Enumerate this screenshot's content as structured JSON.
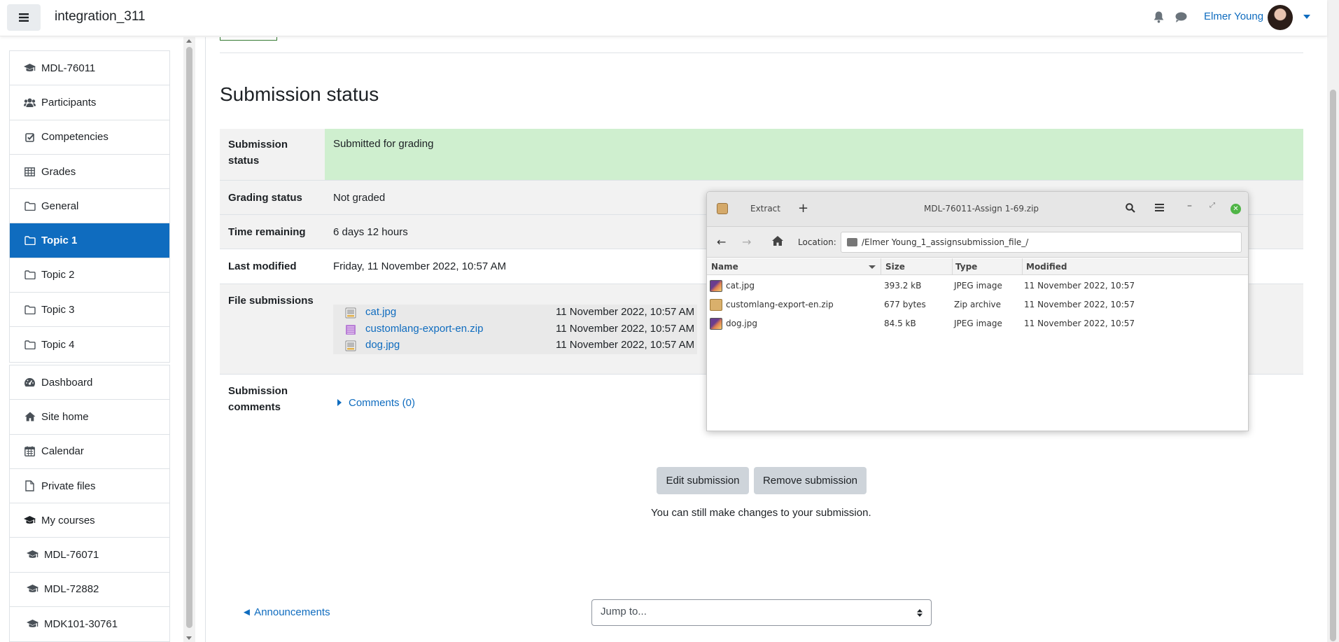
{
  "navbar": {
    "site_name": "integration_311",
    "user_name": "Elmer Young"
  },
  "sidebar": {
    "course_items": [
      {
        "label": "MDL-76011",
        "icon": "graduation-cap-icon"
      },
      {
        "label": "Participants",
        "icon": "users-icon"
      },
      {
        "label": "Competencies",
        "icon": "check-square-icon"
      },
      {
        "label": "Grades",
        "icon": "table-icon"
      },
      {
        "label": "General",
        "icon": "folder-icon"
      },
      {
        "label": "Topic 1",
        "icon": "folder-icon",
        "active": true
      },
      {
        "label": "Topic 2",
        "icon": "folder-icon"
      },
      {
        "label": "Topic 3",
        "icon": "folder-icon"
      },
      {
        "label": "Topic 4",
        "icon": "folder-icon"
      }
    ],
    "site_items": [
      {
        "label": "Dashboard",
        "icon": "tachometer-icon"
      },
      {
        "label": "Site home",
        "icon": "home-icon"
      },
      {
        "label": "Calendar",
        "icon": "calendar-icon"
      },
      {
        "label": "Private files",
        "icon": "file-icon"
      },
      {
        "label": "My courses",
        "icon": "graduation-cap-icon"
      },
      {
        "label": "MDL-76071",
        "icon": "graduation-cap-icon"
      },
      {
        "label": "MDL-72882",
        "icon": "graduation-cap-icon"
      },
      {
        "label": "MDK101-30761",
        "icon": "graduation-cap-icon"
      }
    ]
  },
  "main": {
    "heading": "Submission status",
    "rows": {
      "submission_status": {
        "label": "Submission status",
        "value": "Submitted for grading"
      },
      "grading_status": {
        "label": "Grading status",
        "value": "Not graded"
      },
      "time_remaining": {
        "label": "Time remaining",
        "value": "6 days 12 hours"
      },
      "last_modified": {
        "label": "Last modified",
        "value": "Friday, 11 November 2022, 10:57 AM"
      },
      "file_submissions": {
        "label": "File submissions"
      },
      "submission_comments": {
        "label": "Submission comments",
        "link": "Comments (0)"
      }
    },
    "files": [
      {
        "name": "cat.jpg",
        "date": "11 November 2022, 10:57 AM",
        "type": "image"
      },
      {
        "name": "customlang-export-en.zip",
        "date": "11 November 2022, 10:57 AM",
        "type": "zip"
      },
      {
        "name": "dog.jpg",
        "date": "11 November 2022, 10:57 AM",
        "type": "image"
      }
    ],
    "buttons": {
      "edit": "Edit submission",
      "remove": "Remove submission"
    },
    "note": "You can still make changes to your submission.",
    "prev_activity": "◄ Announcements",
    "jump_to": "Jump to..."
  },
  "archive_window": {
    "extract_label": "Extract",
    "title": "MDL-76011-Assign 1-69.zip",
    "location_label": "Location:",
    "location_path": "/Elmer Young_1_assignsubmission_file_/",
    "columns": {
      "name": "Name",
      "size": "Size",
      "type": "Type",
      "modified": "Modified"
    },
    "entries": [
      {
        "name": "cat.jpg",
        "size": "393.2 kB",
        "type": "JPEG image",
        "modified": "11 November 2022, 10:57",
        "icon": "image"
      },
      {
        "name": "customlang-export-en.zip",
        "size": "677 bytes",
        "type": "Zip archive",
        "modified": "11 November 2022, 10:57",
        "icon": "zip"
      },
      {
        "name": "dog.jpg",
        "size": "84.5 kB",
        "type": "JPEG image",
        "modified": "11 November 2022, 10:57",
        "icon": "image"
      }
    ]
  },
  "colors": {
    "brand_blue": "#0f6cbf",
    "success_bg": "#cfefcf",
    "button_gray": "#ced4da"
  }
}
